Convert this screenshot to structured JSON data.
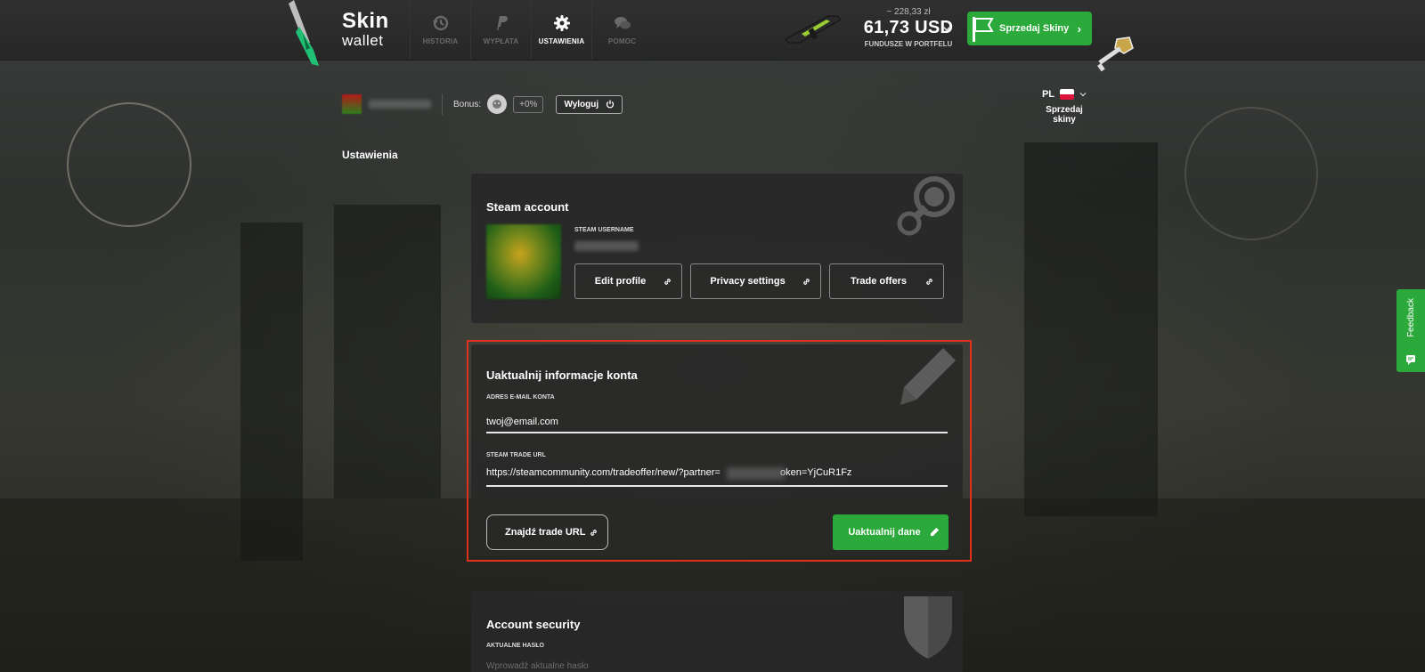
{
  "app": {
    "logo_line1": "Skin",
    "logo_line2": "wallet",
    "accent_color": "#2ba93a",
    "highlight_color": "#e0311c"
  },
  "nav": {
    "items": [
      {
        "label": "HISTORIA",
        "icon": "history-icon",
        "active": false
      },
      {
        "label": "WYPŁATA",
        "icon": "paypal-icon",
        "active": false
      },
      {
        "label": "USTAWIENIA",
        "icon": "gear-icon",
        "active": true
      },
      {
        "label": "POMOC",
        "icon": "chat-bubbles-icon",
        "active": false
      }
    ]
  },
  "balance": {
    "secondary": "~ 228,33 zł",
    "primary": "61,73 USD",
    "caption": "FUNDUSZE W PORTFELU"
  },
  "sell_button": {
    "label": "Sprzedaj Skiny",
    "arrow": "›"
  },
  "userbar": {
    "bonus_label": "Bonus:",
    "bonus_value": "+0%",
    "logout_label": "Wyloguj"
  },
  "language": {
    "code": "PL",
    "sub_label": "Sprzedaj skiny"
  },
  "page_title": "Ustawienia",
  "steam_account": {
    "title": "Steam account",
    "username_label": "STEAM USERNAME",
    "buttons": [
      "Edit profile",
      "Privacy settings",
      "Trade offers"
    ]
  },
  "update_account": {
    "title": "Uaktualnij informacje konta",
    "email_label": "ADRES E-MAIL KONTA",
    "email_value": "twoj@email.com",
    "trade_url_label": "STEAM TRADE URL",
    "trade_url_value": "https://steamcommunity.com/tradeoffer/new/?partner=                      oken=YjCuR1Fz",
    "find_button": "Znajdź trade URL",
    "update_button": "Uaktualnij dane"
  },
  "account_security": {
    "title": "Account security",
    "password_label": "AKTUALNE HASŁO",
    "password_placeholder": "Wprowadź aktualne hasło"
  },
  "feedback": {
    "label": "Feedback"
  }
}
